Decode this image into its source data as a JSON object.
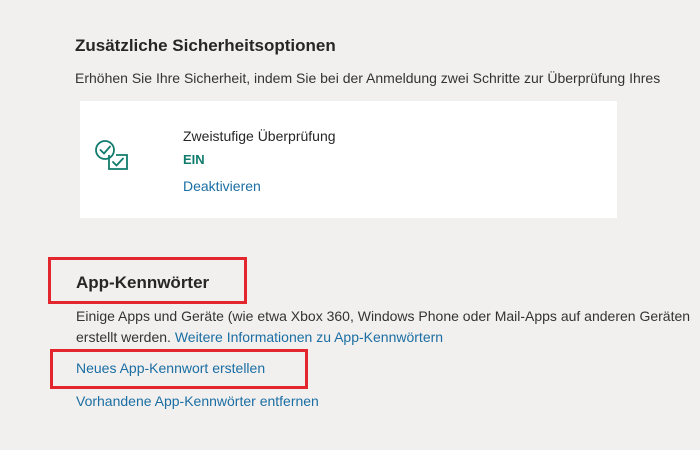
{
  "security": {
    "title": "Zusätzliche Sicherheitsoptionen",
    "description": "Erhöhen Sie Ihre Sicherheit, indem Sie bei der Anmeldung zwei Schritte zur Überprüfung Ihres",
    "two_step": {
      "icon": "two-step-verification-icon",
      "title": "Zweistufige Überprüfung",
      "status": "EIN",
      "status_color": "#107c6d",
      "action_label": "Deaktivieren"
    }
  },
  "app_passwords": {
    "title": "App-Kennwörter",
    "description_line1": "Einige Apps und Geräte (wie etwa Xbox 360, Windows Phone oder Mail-Apps auf anderen Geräten",
    "description_line2_prefix": "erstellt werden. ",
    "more_info_link": "Weitere Informationen zu App-Kennwörtern",
    "create_link": "Neues App-Kennwort erstellen",
    "remove_link": "Vorhandene App-Kennwörter entfernen"
  },
  "colors": {
    "background": "#f2f0ef",
    "link": "#1a6ea3",
    "highlight": "#e3262e"
  }
}
